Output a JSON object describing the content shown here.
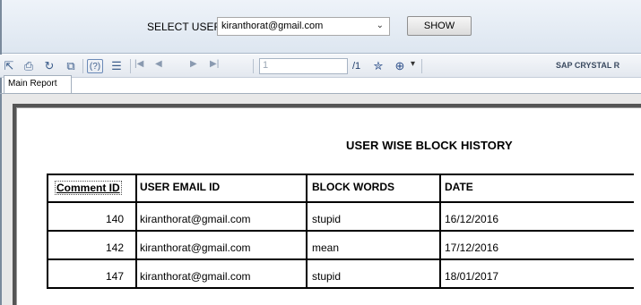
{
  "selector": {
    "label": "SELECT USER:",
    "value": "kiranthorat@gmail.com",
    "show_button": "SHOW"
  },
  "toolbar": {
    "page_value": "1",
    "page_total": "/1",
    "brand": "SAP CRYSTAL R"
  },
  "tabs": [
    "Main Report"
  ],
  "report": {
    "title": "USER WISE BLOCK HISTORY",
    "columns": [
      "Comment ID",
      "USER EMAIL ID",
      "BLOCK WORDS",
      "DATE"
    ],
    "rows": [
      {
        "id": "140",
        "email": "kiranthorat@gmail.com",
        "word": "stupid",
        "date": "16/12/2016"
      },
      {
        "id": "142",
        "email": "kiranthorat@gmail.com",
        "word": "mean",
        "date": "17/12/2016"
      },
      {
        "id": "147",
        "email": "kiranthorat@gmail.com",
        "word": "stupid",
        "date": "18/01/2017"
      }
    ]
  },
  "icons": [
    "export-icon",
    "print-icon",
    "refresh-icon",
    "copy-icon",
    "help-icon",
    "group-tree-icon",
    "first-page-icon",
    "prev-page-icon",
    "next-page-icon",
    "last-page-icon",
    "find-icon",
    "zoom-icon"
  ]
}
